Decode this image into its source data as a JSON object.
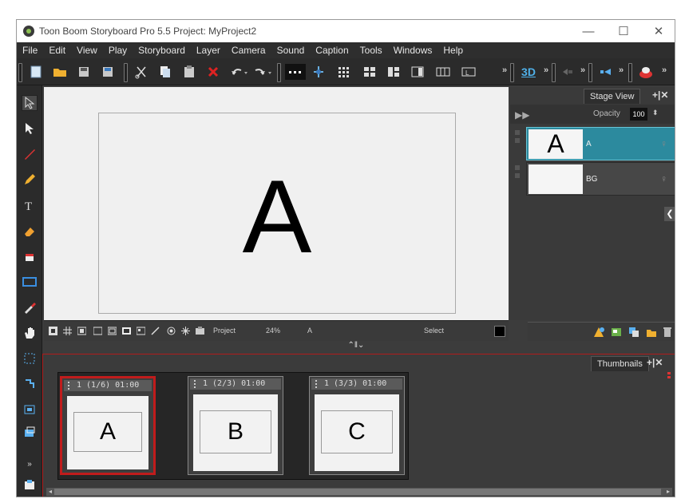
{
  "window": {
    "title": "Toon Boom Storyboard Pro 5.5 Project: MyProject2",
    "minimize": "—",
    "maximize": "☐",
    "close": "✕"
  },
  "menu": [
    "File",
    "Edit",
    "View",
    "Play",
    "Storyboard",
    "Layer",
    "Camera",
    "Sound",
    "Caption",
    "Tools",
    "Windows",
    "Help"
  ],
  "toolbar": {
    "label_3d": "3D"
  },
  "stage": {
    "frame_letter": "A",
    "project_label": "Project",
    "zoom": "24%",
    "layer_name": "A",
    "tool_label": "Select"
  },
  "stage_view": {
    "tab_label": "Stage View",
    "opacity_label": "Opacity",
    "opacity_value": "100",
    "layers": [
      {
        "name": "A",
        "thumb": "A",
        "selected": true
      },
      {
        "name": "BG",
        "thumb": "",
        "selected": false
      }
    ]
  },
  "thumbnails": {
    "tab_label": "Thumbnails",
    "panels": [
      {
        "header": "1 (1/6) 01:00",
        "letter": "A",
        "selected": true
      },
      {
        "header": "1 (2/3) 01:00",
        "letter": "B",
        "selected": false
      },
      {
        "header": "1 (3/3) 01:00",
        "letter": "C",
        "selected": false
      }
    ]
  },
  "colors": {
    "accent_selected_layer": "#2c8a9e",
    "selection_red": "#c01c1c"
  }
}
